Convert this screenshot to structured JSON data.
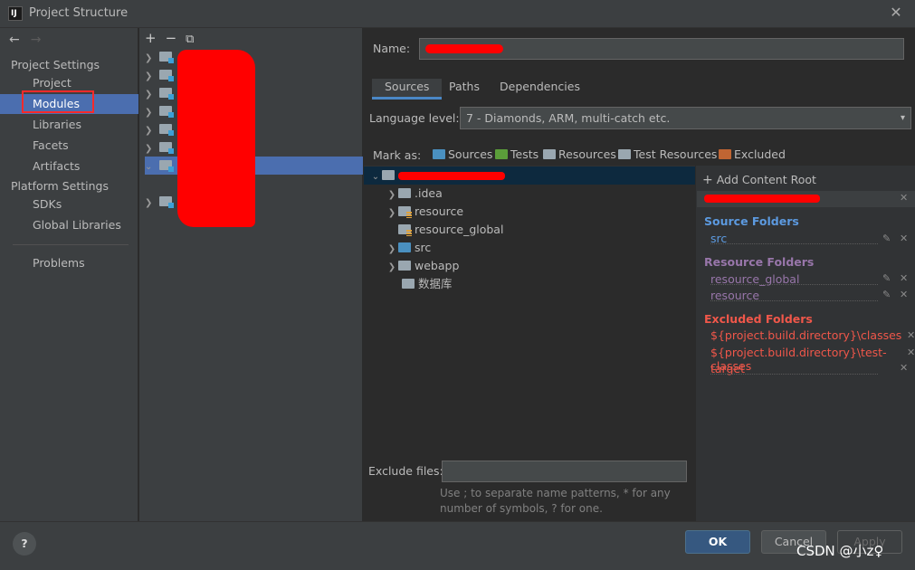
{
  "window": {
    "title": "Project Structure",
    "close_glyph": "✕",
    "app_icon_text": "IJ"
  },
  "sidebar": {
    "back_glyph": "←",
    "forward_glyph": "→",
    "project_settings_label": "Project Settings",
    "items": [
      "Project",
      "Modules",
      "Libraries",
      "Facets",
      "Artifacts"
    ],
    "platform_settings_label": "Platform Settings",
    "platform_items": [
      "SDKs",
      "Global Libraries"
    ],
    "problems_label": "Problems"
  },
  "modules_toolbar": {
    "add": "+",
    "remove": "−",
    "copy": "⧉"
  },
  "name_field": {
    "label": "Name:"
  },
  "tabs": [
    "Sources",
    "Paths",
    "Dependencies"
  ],
  "language_level": {
    "label": "Language level:",
    "value": "7 - Diamonds, ARM, multi-catch etc.",
    "caret": "▾"
  },
  "mark_as": {
    "label": "Mark as:",
    "buttons": [
      {
        "label": "Sources",
        "color": "#4a90c0"
      },
      {
        "label": "Tests",
        "color": "#5b9e3a"
      },
      {
        "label": "Resources",
        "color": "#9aa7b0"
      },
      {
        "label": "Test Resources",
        "color": "#9aa7b0"
      },
      {
        "label": "Excluded",
        "color": "#c06533"
      }
    ]
  },
  "tree": [
    {
      "name": ".idea",
      "expandable": true
    },
    {
      "name": "resource",
      "expandable": true,
      "kind": "res"
    },
    {
      "name": "resource_global",
      "expandable": false,
      "kind": "res"
    },
    {
      "name": "src",
      "expandable": true,
      "kind": "src"
    },
    {
      "name": "webapp",
      "expandable": true
    },
    {
      "name": "数据库",
      "expandable": false
    }
  ],
  "exclude_files": {
    "label": "Exclude files:",
    "hint": "Use ; to separate name patterns, * for any number of symbols, ? for one."
  },
  "roots": {
    "add_label": "Add Content Root",
    "source_header": "Source Folders",
    "source_color": "#5c9ae0",
    "source_items": [
      "src"
    ],
    "resource_header": "Resource Folders",
    "resource_color": "#9876aa",
    "resource_items": [
      "resource_global",
      "resource"
    ],
    "excluded_header": "Excluded Folders",
    "excluded_color": "#f0574a",
    "excluded_items": [
      "${project.build.directory}\\classes",
      "${project.build.directory}\\test-classes",
      "target"
    ]
  },
  "footer": {
    "help": "?",
    "ok": "OK",
    "cancel": "Cancel",
    "apply": "Apply"
  },
  "watermark": "CSDN @小z♀"
}
